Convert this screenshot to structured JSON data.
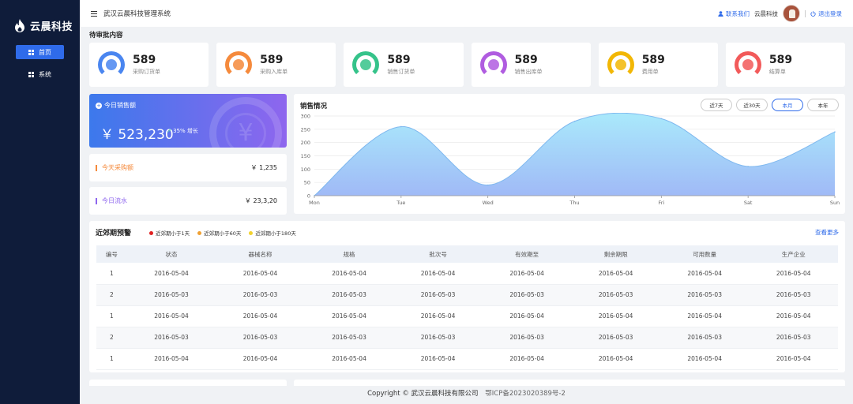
{
  "brand": {
    "name": "云晨科技"
  },
  "sidebar": {
    "items": [
      {
        "label": "首页",
        "active": true
      },
      {
        "label": "系统",
        "active": false
      }
    ]
  },
  "header": {
    "title": "武汉云晨科技管理系统",
    "contact": "联系我们",
    "company": "云晨科技",
    "logout": "退出登录"
  },
  "pending": {
    "title": "待审批内容",
    "cards": [
      {
        "value": "589",
        "label": "采购订货单",
        "color": "#4a86f0",
        "icon": "cart-icon"
      },
      {
        "value": "589",
        "label": "采购入库单",
        "color": "#f58a3c",
        "icon": "basket-icon"
      },
      {
        "value": "589",
        "label": "销售订货单",
        "color": "#35c38a",
        "icon": "document-icon"
      },
      {
        "value": "589",
        "label": "销售出库单",
        "color": "#b05ce0",
        "icon": "warehouse-icon"
      },
      {
        "value": "589",
        "label": "费用单",
        "color": "#f2b705",
        "icon": "money-bag-icon"
      },
      {
        "value": "589",
        "label": "结算单",
        "color": "#f25a5a",
        "icon": "yen-icon"
      }
    ]
  },
  "today_sales": {
    "title": "今日销售额",
    "amount": "￥ 523,230",
    "growth": "35% 增长"
  },
  "stats": [
    {
      "label": "今天采购额",
      "value": "￥ 1,235",
      "color": "#f58a3c"
    },
    {
      "label": "今日流水",
      "value": "￥ 23,3,20",
      "color": "#8e66ee"
    }
  ],
  "sales_chart": {
    "title": "销售情况",
    "ranges": [
      {
        "label": "近7天",
        "active": false
      },
      {
        "label": "近30天",
        "active": false
      },
      {
        "label": "本月",
        "active": true
      },
      {
        "label": "本年",
        "active": false
      }
    ]
  },
  "chart_data": {
    "type": "area",
    "title": "销售情况",
    "categories": [
      "Mon",
      "Tue",
      "Wed",
      "Thu",
      "Fri",
      "Sat",
      "Sun"
    ],
    "values": [
      0,
      260,
      40,
      280,
      290,
      110,
      240
    ],
    "ylim": [
      0,
      300
    ],
    "yticks": [
      0,
      50,
      100,
      150,
      200,
      250,
      300
    ],
    "grid": true,
    "colors": {
      "top": "#a5e8fb",
      "bottom": "#9bb6f6",
      "line": "#7fb8ef"
    }
  },
  "expiry": {
    "title": "近郊期预警",
    "more": "查看更多",
    "legend": [
      {
        "label": "近郊期小于1天",
        "color": "#e02020"
      },
      {
        "label": "近郊期小于60天",
        "color": "#f0a032"
      },
      {
        "label": "近郊期小于180天",
        "color": "#f2d22e"
      }
    ],
    "headers": [
      "编号",
      "状态",
      "器械名称",
      "规格",
      "批次号",
      "有效期至",
      "剩余期限",
      "可用数量",
      "生产企业"
    ],
    "rows": [
      [
        "1",
        "2016-05-04",
        "2016-05-04",
        "2016-05-04",
        "2016-05-04",
        "2016-05-04",
        "2016-05-04",
        "2016-05-04",
        "2016-05-04"
      ],
      [
        "2",
        "2016-05-03",
        "2016-05-03",
        "2016-05-03",
        "2016-05-03",
        "2016-05-03",
        "2016-05-03",
        "2016-05-03",
        "2016-05-03"
      ],
      [
        "1",
        "2016-05-04",
        "2016-05-04",
        "2016-05-04",
        "2016-05-04",
        "2016-05-04",
        "2016-05-04",
        "2016-05-04",
        "2016-05-04"
      ],
      [
        "2",
        "2016-05-03",
        "2016-05-03",
        "2016-05-03",
        "2016-05-03",
        "2016-05-03",
        "2016-05-03",
        "2016-05-03",
        "2016-05-03"
      ],
      [
        "1",
        "2016-05-04",
        "2016-05-04",
        "2016-05-04",
        "2016-05-04",
        "2016-05-04",
        "2016-05-04",
        "2016-05-04",
        "2016-05-04"
      ]
    ]
  },
  "footer": {
    "copyright": "Copyright © 武汉云晨科技有限公司",
    "icp": "鄂ICP备2023020389号-2"
  }
}
